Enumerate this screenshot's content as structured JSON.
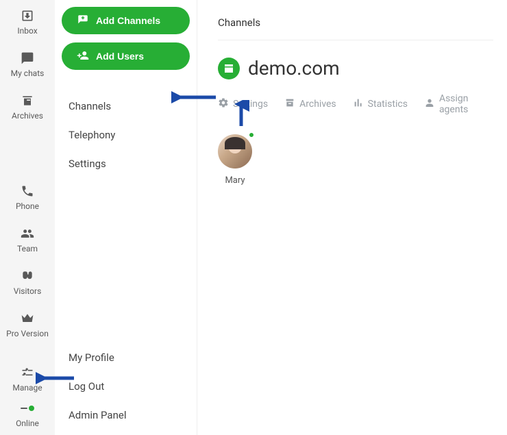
{
  "colors": {
    "accent": "#27ae35"
  },
  "narrow": {
    "items": [
      {
        "key": "inbox",
        "label": "Inbox"
      },
      {
        "key": "mychats",
        "label": "My chats"
      },
      {
        "key": "archives",
        "label": "Archives"
      },
      {
        "key": "phone",
        "label": "Phone"
      },
      {
        "key": "team",
        "label": "Team"
      },
      {
        "key": "visitors",
        "label": "Visitors"
      },
      {
        "key": "proversion",
        "label": "Pro Version"
      },
      {
        "key": "manage",
        "label": "Manage"
      },
      {
        "key": "online",
        "label": "Online"
      }
    ]
  },
  "mid": {
    "buttons": {
      "add_channels": "Add Channels",
      "add_users": "Add Users"
    },
    "items": [
      {
        "label": "Channels"
      },
      {
        "label": "Telephony"
      },
      {
        "label": "Settings"
      }
    ],
    "bottom": [
      {
        "label": "My Profile"
      },
      {
        "label": "Log Out"
      },
      {
        "label": "Admin Panel"
      }
    ]
  },
  "main": {
    "heading": "Channels",
    "channel": {
      "name": "demo.com"
    },
    "tabs": [
      {
        "label": "Settings"
      },
      {
        "label": "Archives"
      },
      {
        "label": "Statistics"
      },
      {
        "label": "Assign agents"
      }
    ],
    "agents": [
      {
        "name": "Mary",
        "presence": "online"
      }
    ]
  }
}
